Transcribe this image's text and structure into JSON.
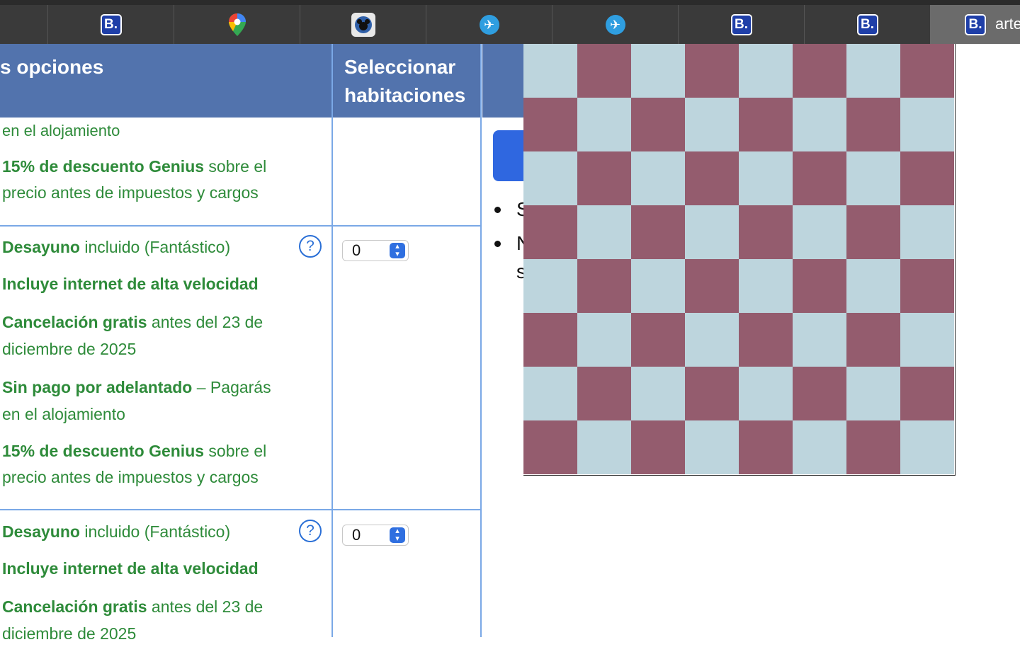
{
  "browser": {
    "tabs": [
      {
        "icon": "blank-tab",
        "label": ""
      },
      {
        "icon": "booking-b-icon",
        "label": ""
      },
      {
        "icon": "google-maps-pin-icon",
        "label": ""
      },
      {
        "icon": "disney-mickey-icon",
        "label": ""
      },
      {
        "icon": "airplane-icon",
        "label": ""
      },
      {
        "icon": "airplane-icon",
        "label": ""
      },
      {
        "icon": "booking-b-icon",
        "label": ""
      },
      {
        "icon": "booking-b-icon",
        "label": ""
      },
      {
        "icon": "booking-b-icon",
        "label": "arte",
        "active": true
      }
    ],
    "b_letter": "B."
  },
  "table": {
    "header_options": "s opciones",
    "header_select_line1": "Seleccionar",
    "header_select_line2": "habitaciones",
    "row0": {
      "line_alojamiento": "en el alojamiento",
      "genius_bold": "15% de descuento Genius",
      "genius_rest": " sobre el",
      "genius_line2": "precio antes de impuestos y cargos"
    },
    "rows": [
      {
        "desayuno_bold": "Desayuno",
        "desayuno_rest": " incluido (Fantástico)",
        "internet": "Incluye internet de alta velocidad",
        "cancel_bold": "Cancelación gratis",
        "cancel_rest": " antes del 23 de",
        "cancel_line2": "diciembre de 2025",
        "prepay_bold": "Sin pago por adelantado",
        "prepay_rest": " – Pagarás",
        "prepay_line2": "en el alojamiento",
        "genius_bold": "15% de descuento Genius",
        "genius_rest": " sobre el",
        "genius_line2": "precio antes de impuestos y cargos",
        "quantity": "0",
        "help": "?"
      },
      {
        "desayuno_bold": "Desayuno",
        "desayuno_rest": " incluido (Fantástico)",
        "internet": "Incluye internet de alta velocidad",
        "cancel_bold": "Cancelación gratis",
        "cancel_rest": " antes del 23 de",
        "cancel_line2": "diciembre de 2025",
        "quantity": "0",
        "help": "?"
      }
    ]
  },
  "side": {
    "bullet1_letter": "S",
    "bullet2_letter": "N",
    "bullet2_line2_letter": "s"
  },
  "overlay": {
    "type": "checkerboard",
    "rows": 8,
    "cols": 8,
    "light_color": "#bdd5dd",
    "dark_color": "#945c6e",
    "first_square": "light"
  },
  "colors": {
    "header_bg": "#5273ad",
    "green_text": "#2e8b3a",
    "grid_line": "#7aa8e6",
    "accent_blue": "#2f67e0"
  }
}
